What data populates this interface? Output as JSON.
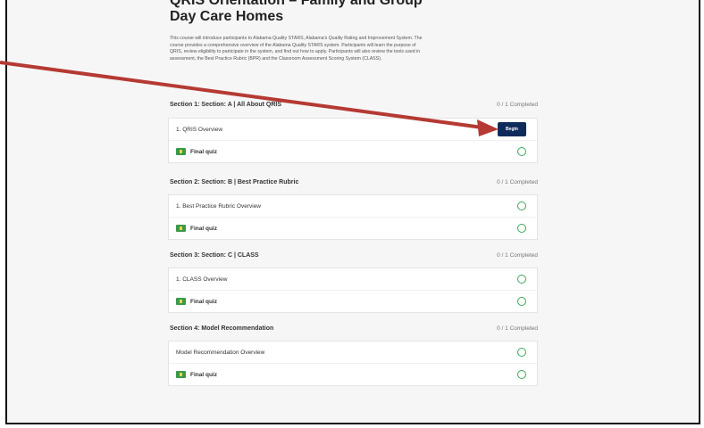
{
  "course": {
    "title": "QRIS Orientation – Family and Group Day Care Homes",
    "description": "This course will introduce participants to Alabama Quality STARS, Alabama's Quality Rating and Improvement System. The course provides a comprehensive overview of the Alabama Quality STARS system. Participants will learn the purpose of QRIS, review eligibility to participate in the system, and find out how to apply. Participants will also review the tools used in assessment, the Best Practice Rubric (BPR) and the Classroom Assessment Scoring System (CLASS)."
  },
  "sections": [
    {
      "title": "Section 1: Section: A | All About QRIS",
      "status": "0 / 1 Completed",
      "items": [
        {
          "label": "1. QRIS Overview",
          "action": "Begin"
        },
        {
          "label": "Final quiz",
          "icon": "quiz-icon"
        }
      ]
    },
    {
      "title": "Section 2: Section: B | Best Practice Rubric",
      "status": "0 / 1 Completed",
      "items": [
        {
          "label": "1. Best Practice Rubric Overview"
        },
        {
          "label": "Final quiz",
          "icon": "quiz-icon"
        }
      ]
    },
    {
      "title": "Section 3: Section: C | CLASS",
      "status": "0 / 1 Completed",
      "items": [
        {
          "label": "1. CLASS Overview"
        },
        {
          "label": "Final quiz",
          "icon": "quiz-icon"
        }
      ]
    },
    {
      "title": "Section 4: Model Recommendation",
      "status": "0 / 1 Completed",
      "items": [
        {
          "label": "Model Recommendation Overview"
        },
        {
          "label": "Final quiz",
          "icon": "quiz-icon"
        }
      ]
    }
  ],
  "colors": {
    "accent": "#0f2b5b",
    "complete_ring": "#3aa65a",
    "arrow": "#b53a33"
  }
}
